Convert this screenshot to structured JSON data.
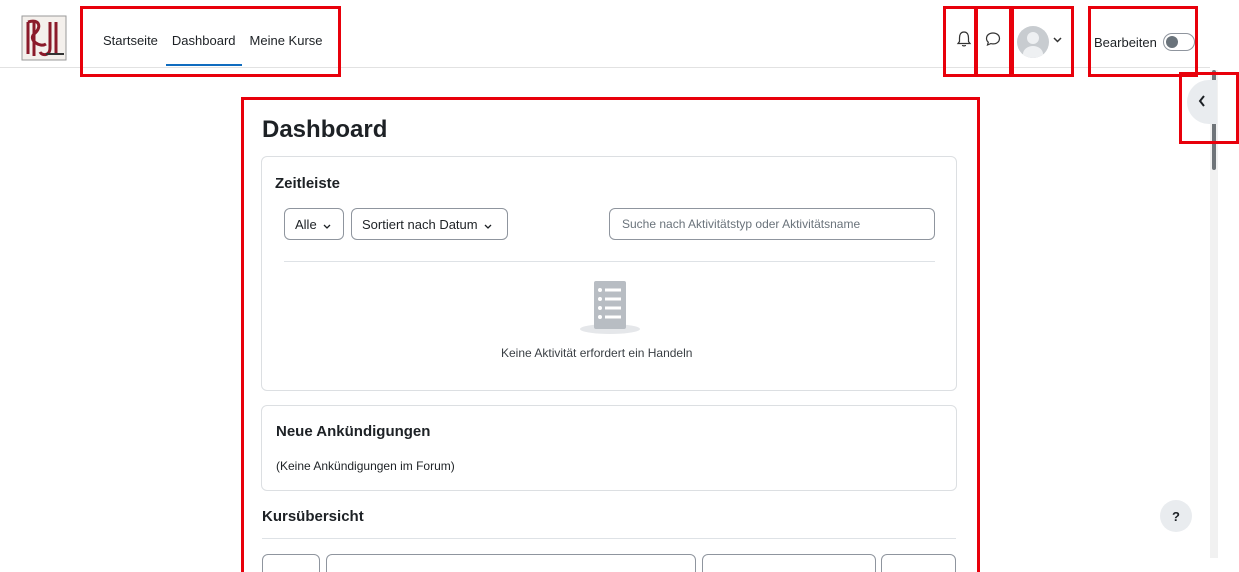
{
  "nav": {
    "links": [
      "Startseite",
      "Dashboard",
      "Meine Kurse"
    ],
    "active": "Dashboard",
    "edit_label": "Bearbeiten",
    "icons": [
      "bell-icon",
      "chat-icon",
      "avatar",
      "chevron-down-icon"
    ]
  },
  "page": {
    "title": "Dashboard"
  },
  "timeline": {
    "title": "Zeitleiste",
    "filter_label": "Alle",
    "sort_label": "Sortiert nach Datum",
    "search_placeholder": "Suche nach Aktivitätstyp oder Aktivitätsname",
    "empty_text": "Keine Aktivität erfordert ein Handeln"
  },
  "announcements": {
    "title": "Neue Ankündigungen",
    "text": "(Keine Ankündigungen im Forum)"
  },
  "course_overview": {
    "title": "Kursübersicht"
  },
  "help": {
    "label": "?"
  },
  "colors": {
    "accent": "#0f6cbf",
    "highlight": "#e8000b"
  }
}
